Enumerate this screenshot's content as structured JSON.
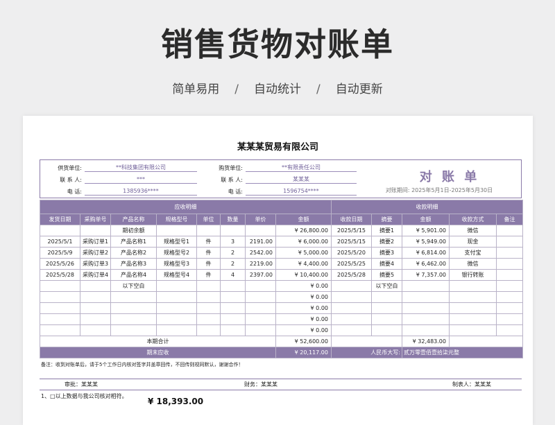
{
  "hero": {
    "title": "销售货物对账单",
    "subtitle": [
      "简单易用",
      "自动统计",
      "自动更新"
    ],
    "separator": "/"
  },
  "sheet": {
    "company": "某某某贸易有限公司",
    "info": {
      "supplier_label": "供货单位:",
      "supplier_value": "**科技集团有限公司",
      "buyer_label": "购货单位:",
      "buyer_value": "**有限责任公司",
      "contact_label": "联 系 人:",
      "contact_value_left": "***",
      "contact_value_right": "某某某",
      "phone_label": "电    话:",
      "phone_value_left": "1385936****",
      "phone_value_right": "1596754****",
      "doc_title": "对 账 单",
      "period": "对账期间:  2025年5月1日-2025年5月30日"
    },
    "sections": {
      "receivable": "应收明细",
      "received": "收款明细"
    },
    "columns": [
      "发货日期",
      "采购单号",
      "产品名称",
      "规格型号",
      "单位",
      "数量",
      "单价",
      "金额",
      "收款日期",
      "摘要",
      "金额",
      "收款方式",
      "备注"
    ],
    "rows": [
      [
        "",
        "",
        "期初余额",
        "",
        "",
        "",
        "",
        "¥ 26,800.00",
        "2025/5/15",
        "摘要1",
        "¥ 5,901.00",
        "微信",
        ""
      ],
      [
        "2025/5/1",
        "采购订单1",
        "产品名称1",
        "规格型号1",
        "件",
        "3",
        "2191.00",
        "¥ 6,000.00",
        "2025/5/15",
        "摘要2",
        "¥ 5,949.00",
        "现金",
        ""
      ],
      [
        "2025/5/9",
        "采购订单2",
        "产品名称2",
        "规格型号2",
        "件",
        "2",
        "2542.00",
        "¥ 5,000.00",
        "2025/5/20",
        "摘要3",
        "¥ 6,814.00",
        "支付宝",
        ""
      ],
      [
        "2025/5/26",
        "采购订单3",
        "产品名称3",
        "规格型号3",
        "件",
        "2",
        "2219.00",
        "¥ 4,400.00",
        "2025/5/25",
        "摘要4",
        "¥ 6,462.00",
        "微信",
        ""
      ],
      [
        "2025/5/28",
        "采购订单4",
        "产品名称4",
        "规格型号4",
        "件",
        "4",
        "2397.00",
        "¥ 10,400.00",
        "2025/5/28",
        "摘要5",
        "¥ 7,357.00",
        "银行转账",
        ""
      ],
      [
        "",
        "",
        "以下空白",
        "",
        "",
        "",
        "",
        "¥ 0.00",
        "",
        "以下空白",
        "",
        "",
        ""
      ],
      [
        "",
        "",
        "",
        "",
        "",
        "",
        "",
        "¥ 0.00",
        "",
        "",
        "",
        "",
        ""
      ],
      [
        "",
        "",
        "",
        "",
        "",
        "",
        "",
        "¥ 0.00",
        "",
        "",
        "",
        "",
        ""
      ],
      [
        "",
        "",
        "",
        "",
        "",
        "",
        "",
        "¥ 0.00",
        "",
        "",
        "",
        "",
        ""
      ],
      [
        "",
        "",
        "",
        "",
        "",
        "",
        "",
        "¥ 0.00",
        "",
        "",
        "",
        "",
        ""
      ]
    ],
    "total": {
      "label": "本期合计",
      "receivable": "¥ 52,600.00",
      "received": "¥ 32,483.00"
    },
    "ending": {
      "label": "期末应收",
      "value": "¥ 20,117.00",
      "rmb_label": "人民币大写:",
      "rmb_value": "贰万零壹佰壹拾柒元整"
    },
    "note": "备注：收到对账单后，请于5个工作日内核对签字并盖章回传，不回传则视同默认，谢谢合作！",
    "signatures": {
      "review": "审批：某某某",
      "finance": "财务：某某某",
      "maker": "制表人：某某某"
    },
    "footer": {
      "line1": "1、□以上数据与我公司核对相符。",
      "amount": "¥ 18,393.00"
    }
  }
}
